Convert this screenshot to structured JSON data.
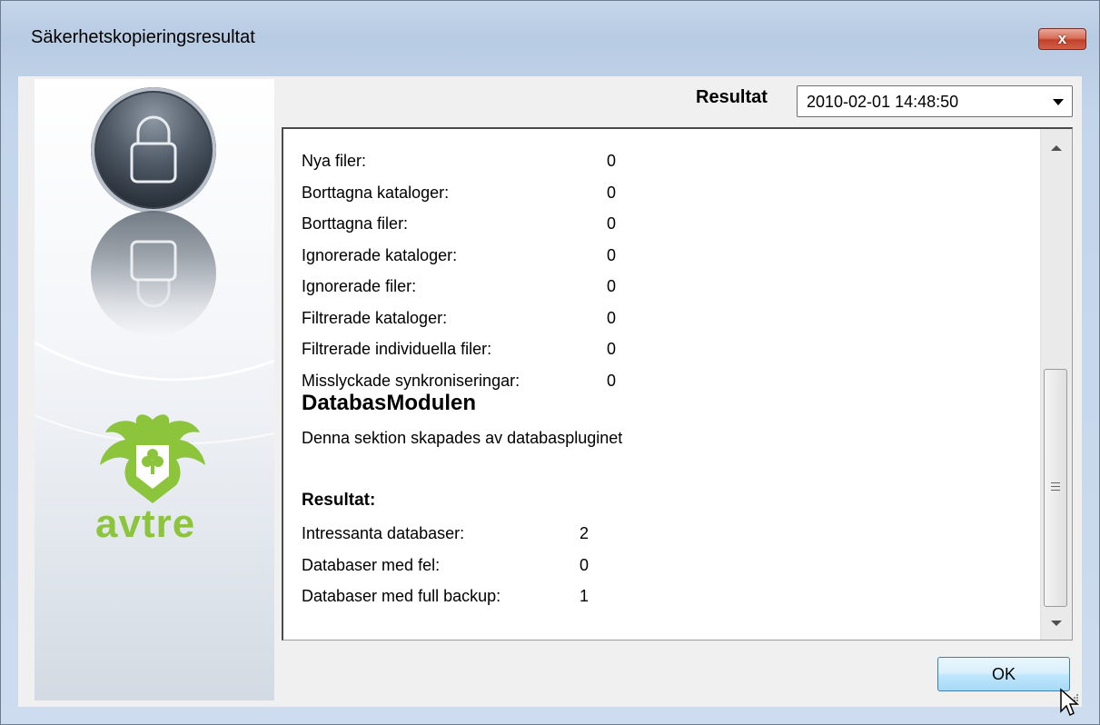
{
  "window": {
    "title": "Säkerhetskopieringsresultat",
    "close_label": "x"
  },
  "sidebar": {
    "brand": "avtre"
  },
  "results_selector": {
    "label": "Resultat",
    "selected": "2010-02-01 14:48:50"
  },
  "report": {
    "rows": [
      {
        "label": "Nya filer:",
        "value": "0"
      },
      {
        "label": "Borttagna kataloger:",
        "value": "0"
      },
      {
        "label": "Borttagna filer:",
        "value": "0"
      },
      {
        "label": "Ignorerade kataloger:",
        "value": "0"
      },
      {
        "label": "Ignorerade filer:",
        "value": "0"
      },
      {
        "label": "Filtrerade kataloger:",
        "value": "0"
      },
      {
        "label": "Filtrerade individuella filer:",
        "value": "0"
      },
      {
        "label": "Misslyckade synkroniseringar:",
        "value": "0"
      }
    ],
    "module_title": "DatabasModulen",
    "module_description": "Denna sektion skapades av databaspluginet",
    "result_heading": "Resultat:",
    "result_rows": [
      {
        "label": "Intressanta databaser:",
        "value": "2"
      },
      {
        "label": "Databaser med fel:",
        "value": "0"
      },
      {
        "label": "Databaser med full backup:",
        "value": "1"
      }
    ]
  },
  "buttons": {
    "ok_label": "OK"
  },
  "colors": {
    "brand_green": "#8cc43c",
    "ok_border": "#3c7fb1",
    "close_red": "#c2402a"
  }
}
